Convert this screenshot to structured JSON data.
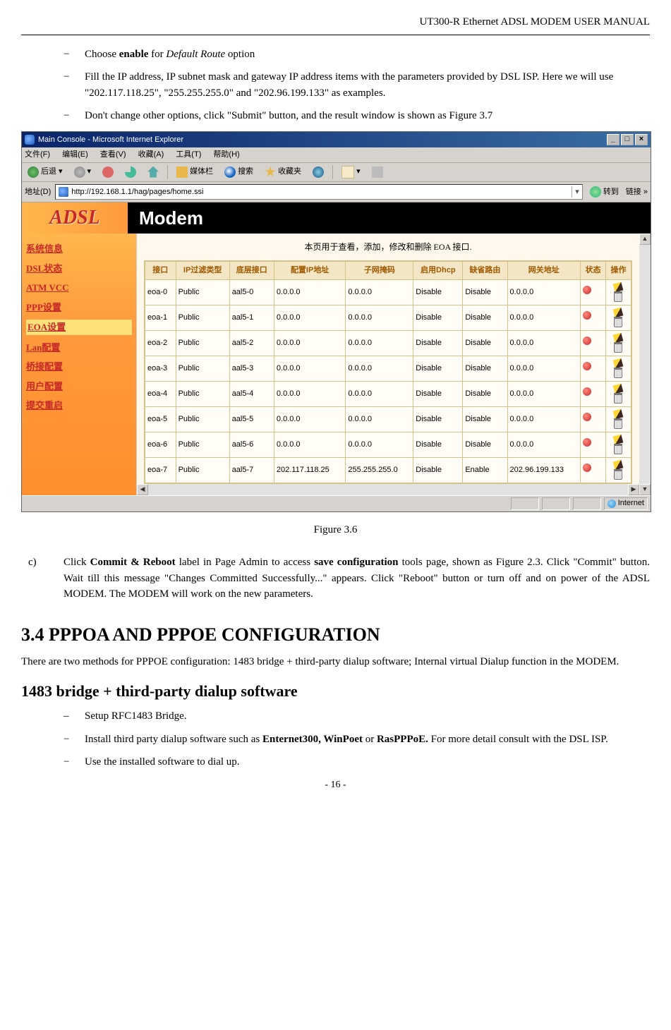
{
  "header": "UT300-R Ethernet ADSL MODEM USER MANUAL",
  "bullets_top": [
    {
      "pre": "Choose ",
      "bold": "enable",
      "mid": " for ",
      "italic": "Default Route",
      "post": " option"
    },
    {
      "plain": "Fill the IP address, IP subnet mask and gateway IP address items with the parameters provided by DSL ISP. Here we will use \"202.117.118.25\", \"255.255.255.0\" and \"202.96.199.133\" as examples."
    },
    {
      "plain": "Don't change other options, click \"Submit\" button, and the result window is shown as Figure 3.7"
    }
  ],
  "ie": {
    "title": "Main Console - Microsoft Internet Explorer",
    "menus": [
      "文件(F)",
      "编辑(E)",
      "查看(V)",
      "收藏(A)",
      "工具(T)",
      "帮助(H)"
    ],
    "toolbar": {
      "back": "后退",
      "favbar": "媒体栏",
      "search": "搜索",
      "fav": "收藏夹"
    },
    "addr_label": "地址(D)",
    "url": "http://192.168.1.1/hag/pages/home.ssi",
    "go": "转到",
    "links": "链接",
    "banner_adsl": "ADSL",
    "banner_modem": "Modem",
    "sidebar": [
      "系统信息",
      "DSL状态",
      "ATM VCC",
      "PPP设置",
      "EOA设置",
      "Lan配置",
      "桥接配置",
      "用户配置",
      "提交重启"
    ],
    "sidebar_selected_index": 4,
    "panel_caption": "本页用于查看，添加，修改和删除 EOA 接口.",
    "columns": [
      "接口",
      "IP过滤类型",
      "底层接口",
      "配置IP地址",
      "子网掩码",
      "启用Dhcp",
      "缺省路由",
      "网关地址",
      "状态",
      "操作"
    ],
    "rows": [
      {
        "iface": "eoa-0",
        "filt": "Public",
        "lower": "aal5-0",
        "ip": "0.0.0.0",
        "mask": "0.0.0.0",
        "dhcp": "Disable",
        "route": "Disable",
        "gw": "0.0.0.0"
      },
      {
        "iface": "eoa-1",
        "filt": "Public",
        "lower": "aal5-1",
        "ip": "0.0.0.0",
        "mask": "0.0.0.0",
        "dhcp": "Disable",
        "route": "Disable",
        "gw": "0.0.0.0"
      },
      {
        "iface": "eoa-2",
        "filt": "Public",
        "lower": "aal5-2",
        "ip": "0.0.0.0",
        "mask": "0.0.0.0",
        "dhcp": "Disable",
        "route": "Disable",
        "gw": "0.0.0.0"
      },
      {
        "iface": "eoa-3",
        "filt": "Public",
        "lower": "aal5-3",
        "ip": "0.0.0.0",
        "mask": "0.0.0.0",
        "dhcp": "Disable",
        "route": "Disable",
        "gw": "0.0.0.0"
      },
      {
        "iface": "eoa-4",
        "filt": "Public",
        "lower": "aal5-4",
        "ip": "0.0.0.0",
        "mask": "0.0.0.0",
        "dhcp": "Disable",
        "route": "Disable",
        "gw": "0.0.0.0"
      },
      {
        "iface": "eoa-5",
        "filt": "Public",
        "lower": "aal5-5",
        "ip": "0.0.0.0",
        "mask": "0.0.0.0",
        "dhcp": "Disable",
        "route": "Disable",
        "gw": "0.0.0.0"
      },
      {
        "iface": "eoa-6",
        "filt": "Public",
        "lower": "aal5-6",
        "ip": "0.0.0.0",
        "mask": "0.0.0.0",
        "dhcp": "Disable",
        "route": "Disable",
        "gw": "0.0.0.0"
      },
      {
        "iface": "eoa-7",
        "filt": "Public",
        "lower": "aal5-7",
        "ip": "202.117.118.25",
        "mask": "255.255.255.0",
        "dhcp": "Disable",
        "route": "Enable",
        "gw": "202.96.199.133"
      }
    ],
    "status_text": "Internet"
  },
  "fig_caption": "Figure 3.6",
  "step_c": {
    "marker": "c)",
    "pre": "Click ",
    "b1": "Commit & Reboot",
    "mid1": " label in Page Admin to access ",
    "b2": "save configuration",
    "post": " tools page, shown as Figure 2.3. Click \"Commit\" button. Wait till this message \"Changes Committed Successfully...\" appears. Click \"Reboot\" button or turn off and on power of the ADSL MODEM. The MODEM will work on the new parameters."
  },
  "section_heading": "3.4 PPPOA AND PPPOE CONFIGURATION",
  "section_para": "There are two methods for PPPOE configuration: 1483 bridge + third-party dialup software; Internal virtual Dialup function in the MODEM.",
  "sub_heading": "1483 bridge + third-party dialup software",
  "bullets_bottom": [
    {
      "plain": "Setup RFC1483 Bridge."
    },
    {
      "pre": "Install third party dialup software such as ",
      "bold": "Enternet300, WinPoet",
      "mid": " or ",
      "bold2": "RasPPPoE.",
      "post": " For more detail consult with the DSL ISP."
    },
    {
      "plain": "Use the installed software to dial up."
    }
  ],
  "footer": "- 16 -"
}
